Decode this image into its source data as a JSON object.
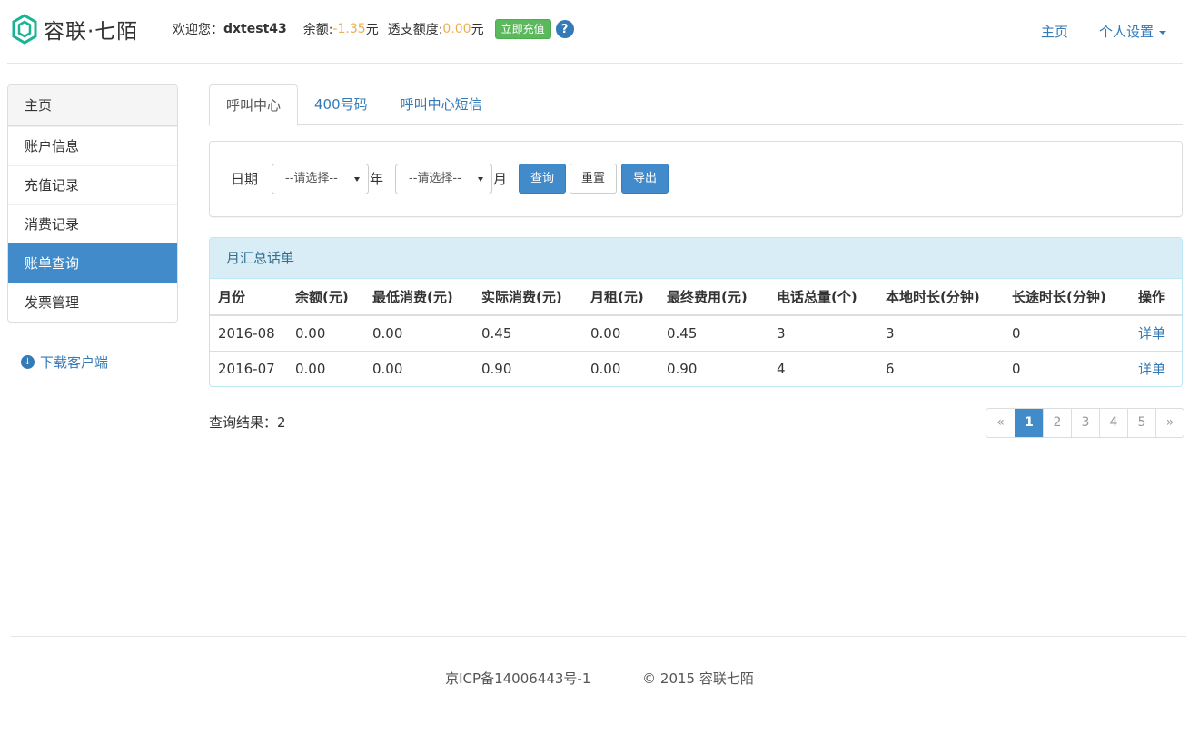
{
  "header": {
    "logo_text": "容联·七陌",
    "welcome_label": "欢迎您：",
    "username": "dxtest43",
    "balance_label": "余额:",
    "balance_value": "-1.35",
    "balance_unit": "元",
    "overdraft_label": "透支额度:",
    "overdraft_value": "0.00",
    "overdraft_unit": "元",
    "recharge_button": "立即充值",
    "help_icon": "?",
    "nav_home": "主页",
    "nav_settings": "个人设置"
  },
  "sidebar": {
    "title": "主页",
    "items": [
      {
        "label": "账户信息"
      },
      {
        "label": "充值记录"
      },
      {
        "label": "消费记录"
      },
      {
        "label": "账单查询"
      },
      {
        "label": "发票管理"
      }
    ],
    "active_index": 3,
    "download_label": "下载客户端"
  },
  "tabs": [
    {
      "label": "呼叫中心"
    },
    {
      "label": "400号码"
    },
    {
      "label": "呼叫中心短信"
    }
  ],
  "filter": {
    "date_label": "日期",
    "year_select": "--请选择--",
    "year_label": "年",
    "month_select": "--请选择--",
    "month_label": "月",
    "query_button": "查询",
    "reset_button": "重置",
    "export_button": "导出"
  },
  "table": {
    "title": "月汇总话单",
    "columns": [
      "月份",
      "余额(元)",
      "最低消费(元)",
      "实际消费(元)",
      "月租(元)",
      "最终费用(元)",
      "电话总量(个)",
      "本地时长(分钟)",
      "长途时长(分钟)",
      "操作"
    ],
    "rows": [
      [
        "2016-08",
        "0.00",
        "0.00",
        "0.45",
        "0.00",
        "0.45",
        "3",
        "3",
        "0",
        "详单"
      ],
      [
        "2016-07",
        "0.00",
        "0.00",
        "0.90",
        "0.00",
        "0.90",
        "4",
        "6",
        "0",
        "详单"
      ]
    ]
  },
  "result": {
    "label": "查询结果：2"
  },
  "pagination": {
    "prev": "«",
    "pages": [
      "1",
      "2",
      "3",
      "4",
      "5"
    ],
    "next": "»",
    "current": "1"
  },
  "footer": {
    "icp": "京ICP备14006443号-1",
    "copyright": "© 2015 容联七陌"
  },
  "colors": {
    "primary": "#428bca",
    "link": "#337ab7",
    "success": "#5cb85c",
    "warning": "#f0ad4e",
    "info_bg": "#d9edf7"
  }
}
